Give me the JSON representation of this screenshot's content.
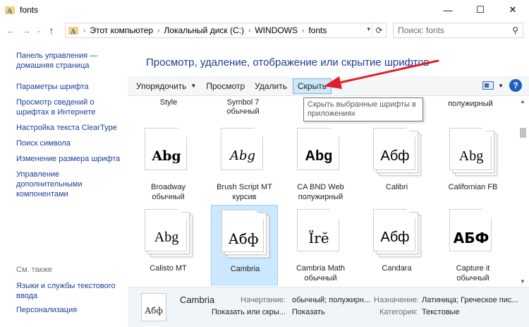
{
  "window": {
    "title": "fonts",
    "controls": {
      "minimize": "—",
      "maximize": "☐",
      "close": "✕"
    }
  },
  "nav": {
    "back": "←",
    "forward": "→",
    "recent": "⌄",
    "up": "↑"
  },
  "address": {
    "crumbs": [
      "Этот компьютер",
      "Локальный диск (C:)",
      "WINDOWS",
      "fonts"
    ]
  },
  "search": {
    "placeholder": "Поиск: fonts"
  },
  "sidebar": {
    "home": "Панель управления — домашняя страница",
    "links": [
      "Параметры шрифта",
      "Просмотр сведений о шрифтах в Интернете",
      "Настройка текста ClearType",
      "Поиск символа",
      "Изменение размера шрифта",
      "Управление дополнительными компонентами"
    ],
    "see_also_title": "См. также",
    "see_also": [
      "Языки и службы текстового ввода",
      "Персонализация"
    ]
  },
  "heading": "Просмотр, удаление, отображение или скрытие шрифтов",
  "toolbar": {
    "organize": "Упорядочить",
    "preview": "Просмотр",
    "delete": "Удалить",
    "hide": "Скрыть",
    "help": "?"
  },
  "tooltip": "Скрыть выбранные шрифты в приложениях",
  "top_row": [
    "Style",
    "Symbol 7 обычный",
    "полужирный"
  ],
  "fonts": [
    {
      "name": "Broadway обычный",
      "sample": "Abg",
      "stack": 1
    },
    {
      "name": "Brush Script MT курсив",
      "sample": "Abg",
      "stack": 1
    },
    {
      "name": "CA BND Web полужирный",
      "sample": "Abg",
      "stack": 1
    },
    {
      "name": "Calibri",
      "sample": "Абф",
      "stack": 3
    },
    {
      "name": "Californian FB",
      "sample": "Abg",
      "stack": 3
    },
    {
      "name": "Calisto MT",
      "sample": "Abg",
      "stack": 3
    },
    {
      "name": "Cambria",
      "sample": "Абф",
      "stack": 3,
      "selected": true
    },
    {
      "name": "Cambria Math обычный",
      "sample": "Ïrĕ",
      "stack": 1
    },
    {
      "name": "Candara",
      "sample": "Абф",
      "stack": 3
    },
    {
      "name": "Capture it обычный",
      "sample": "АБФ",
      "stack": 1
    }
  ],
  "details": {
    "name": "Cambria",
    "sample": "Абф",
    "k_style": "Начертание:",
    "v_style": "обычный; полужирн...",
    "k_lang": "Назначение:",
    "v_lang": "Латиница; Греческое пис...",
    "v_show_hide": "Показать или скры...",
    "v_show": "Показать",
    "k_category": "Категория:",
    "v_category": "Текстовые"
  },
  "colors": {
    "link": "#1a3e9a",
    "heading": "#1e3c96",
    "selection": "#cce8ff",
    "arrow": "#e0202a"
  }
}
